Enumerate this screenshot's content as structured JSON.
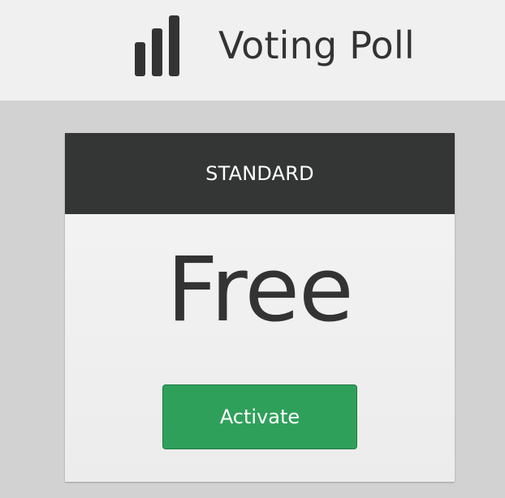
{
  "header": {
    "app_title": "Voting Poll",
    "logo_icon": "bar-chart-icon"
  },
  "plan_card": {
    "tier_label": "STANDARD",
    "price_text": "Free",
    "activate_label": "Activate"
  },
  "colors": {
    "header_background": "#f0f0f0",
    "page_background": "#d2d2d2",
    "card_header_background": "#343635",
    "card_body_background": "#f0f0f0",
    "text_dark": "#333333",
    "activate_button": "#2fa05a"
  }
}
